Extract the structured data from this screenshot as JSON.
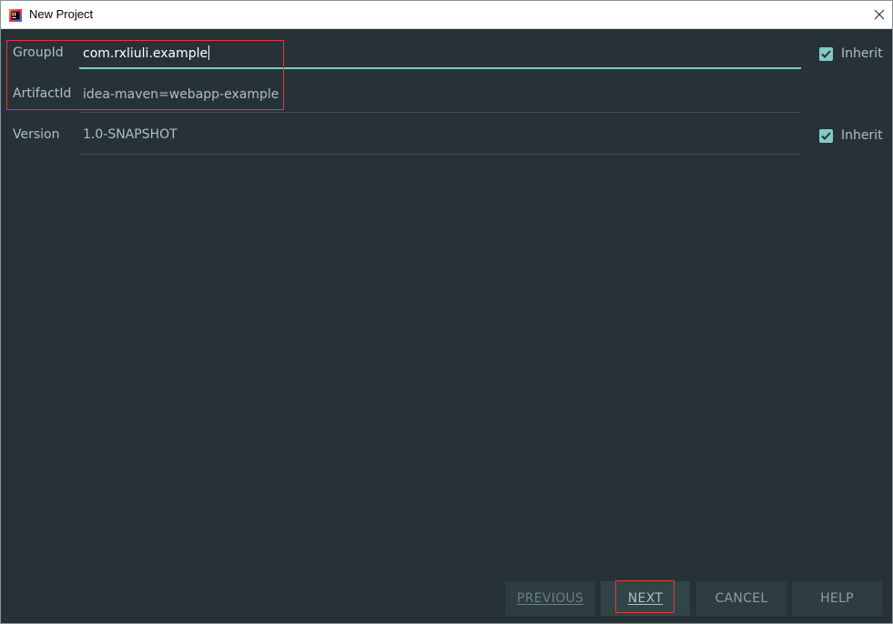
{
  "window": {
    "title": "New Project",
    "app_icon": "intellij-idea-icon",
    "close_icon": "close-icon"
  },
  "form": {
    "group_id": {
      "label": "GroupId",
      "value": "com.rxliuli.example",
      "focused": true
    },
    "artifact_id": {
      "label": "ArtifactId",
      "value": "idea-maven=webapp-example"
    },
    "version": {
      "label": "Version",
      "value": "1.0-SNAPSHOT"
    },
    "group_inherit": {
      "label": "Inherit",
      "checked": true
    },
    "version_inherit": {
      "label": "Inherit",
      "checked": true
    }
  },
  "buttons": {
    "previous_label": "PREVIOUS",
    "next_label": "NEXT",
    "cancel_label": "CANCEL",
    "help_label": "HELP"
  },
  "colors": {
    "background": "#263238",
    "accent": "#80cbc4",
    "text": "#b0bec5",
    "annotation_red": "#e53935"
  }
}
